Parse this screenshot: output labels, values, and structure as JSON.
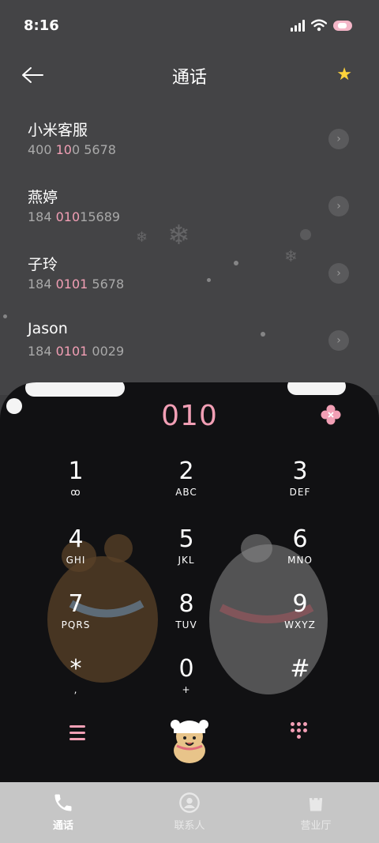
{
  "status_bar": {
    "time": "8:16"
  },
  "header": {
    "title": "通话"
  },
  "contacts": [
    {
      "name": "小米客服",
      "num_pre": "400 ",
      "num_hl": "10",
      "num_post": "0 5678"
    },
    {
      "name": "燕婷",
      "num_pre": "184 ",
      "num_hl": "010",
      "num_post": "15689"
    },
    {
      "name": "子玲",
      "num_pre": "184 ",
      "num_hl": "0101",
      "num_post": " 5678"
    },
    {
      "name": "Jason",
      "num_pre": "184 ",
      "num_hl": "0101",
      "num_post": " 0029"
    }
  ],
  "dialer": {
    "input": "010",
    "keys": [
      {
        "digit": "1",
        "letters": ""
      },
      {
        "digit": "2",
        "letters": "ABC"
      },
      {
        "digit": "3",
        "letters": "DEF"
      },
      {
        "digit": "4",
        "letters": "GHI"
      },
      {
        "digit": "5",
        "letters": "JKL"
      },
      {
        "digit": "6",
        "letters": "MNO"
      },
      {
        "digit": "7",
        "letters": "PQRS"
      },
      {
        "digit": "8",
        "letters": "TUV"
      },
      {
        "digit": "9",
        "letters": "WXYZ"
      },
      {
        "digit": "*",
        "letters": ","
      },
      {
        "digit": "0",
        "letters": "+"
      },
      {
        "digit": "#",
        "letters": ""
      }
    ]
  },
  "tabs": [
    {
      "label": "通话",
      "icon": "phone-icon",
      "active": true
    },
    {
      "label": "联系人",
      "icon": "person-icon",
      "active": false
    },
    {
      "label": "营业厅",
      "icon": "shop-icon",
      "active": false
    }
  ],
  "colors": {
    "accent": "#f29fb5",
    "star": "#ffd43b"
  }
}
